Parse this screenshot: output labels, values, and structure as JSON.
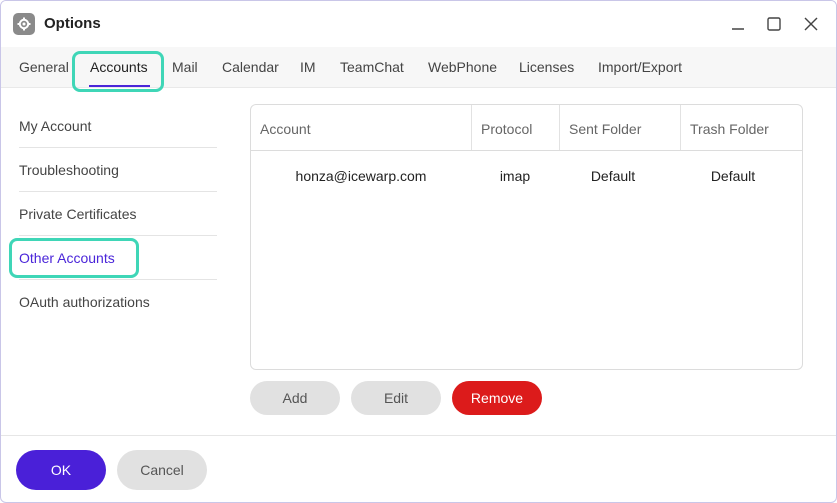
{
  "window": {
    "title": "Options",
    "icon": "gear-icon",
    "controls": [
      "minimize-icon",
      "maximize-icon",
      "close-icon"
    ]
  },
  "tabs": [
    {
      "label": "General"
    },
    {
      "label": "Accounts",
      "active": true
    },
    {
      "label": "Mail"
    },
    {
      "label": "Calendar"
    },
    {
      "label": "IM"
    },
    {
      "label": "TeamChat"
    },
    {
      "label": "WebPhone"
    },
    {
      "label": "Licenses"
    },
    {
      "label": "Import/Export"
    }
  ],
  "sidebar": {
    "items": [
      {
        "label": "My Account"
      },
      {
        "label": "Troubleshooting"
      },
      {
        "label": "Private Certificates"
      },
      {
        "label": "Other Accounts",
        "selected": true
      },
      {
        "label": "OAuth authorizations"
      }
    ]
  },
  "accounts_table": {
    "headers": [
      "Account",
      "Protocol",
      "Sent Folder",
      "Trash Folder"
    ],
    "rows": [
      [
        "honza@icewarp.com",
        "imap",
        "Default",
        "Default"
      ]
    ]
  },
  "actions": {
    "add": "Add",
    "edit": "Edit",
    "remove": "Remove"
  },
  "footer": {
    "ok": "OK",
    "cancel": "Cancel"
  },
  "colors": {
    "accent": "#4a20d8",
    "focus_ring": "#3fd6b7",
    "danger": "#dc1b1b"
  }
}
